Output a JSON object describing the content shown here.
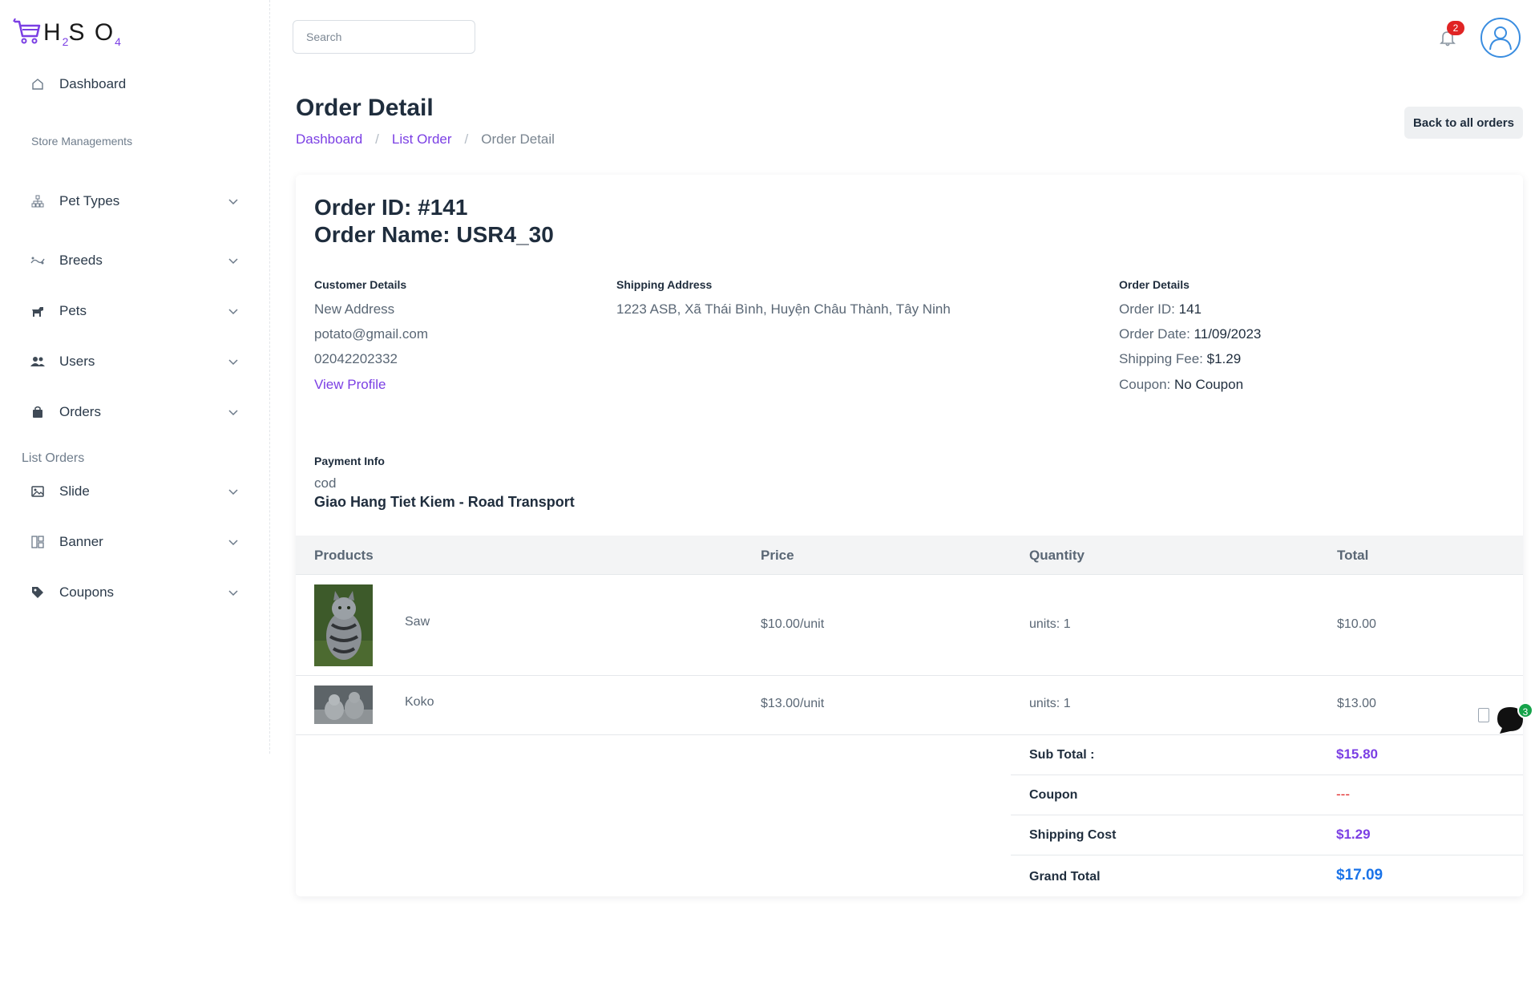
{
  "app": {
    "logo": {
      "letters": [
        "H",
        "S",
        "O"
      ],
      "subscripts": [
        "2",
        "4"
      ]
    }
  },
  "sidebar": {
    "dashboard_label": "Dashboard",
    "section_store": "Store Managements",
    "items": [
      {
        "label": "Pet Types",
        "icon": "sitemap-icon"
      },
      {
        "label": "Breeds",
        "icon": "paw-icon"
      },
      {
        "label": "Pets",
        "icon": "dog-icon"
      },
      {
        "label": "Users",
        "icon": "users-icon"
      },
      {
        "label": "Orders",
        "icon": "bag-icon"
      },
      {
        "label": "Slide",
        "icon": "image-icon"
      },
      {
        "label": "Banner",
        "icon": "layout-icon"
      },
      {
        "label": "Coupons",
        "icon": "tag-icon"
      }
    ],
    "section_list_orders": "List Orders"
  },
  "topbar": {
    "search_placeholder": "Search",
    "notification_count": "2"
  },
  "header": {
    "title": "Order Detail",
    "breadcrumb": [
      "Dashboard",
      "List Order",
      "Order Detail"
    ],
    "back_button": "Back to all orders"
  },
  "order": {
    "id_line": "Order ID: #141",
    "name_line": "Order Name: USR4_30",
    "customer": {
      "title": "Customer Details",
      "address": "New Address",
      "email": "potato@gmail.com",
      "phone": "02042202332",
      "view_profile": "View Profile"
    },
    "shipping": {
      "title": "Shipping Address",
      "address": "1223 ASB, Xã Thái Bình, Huyện Châu Thành, Tây Ninh"
    },
    "details": {
      "title": "Order Details",
      "order_id_label": "Order ID:",
      "order_id_value": "141",
      "order_date_label": "Order Date:",
      "order_date_value": "11/09/2023",
      "shipping_fee_label": "Shipping Fee:",
      "shipping_fee_value": "$1.29",
      "coupon_label": "Coupon:",
      "coupon_value": "No Coupon"
    },
    "payment": {
      "title": "Payment Info",
      "method": "cod",
      "shipping_method": "Giao Hang Tiet Kiem - Road Transport"
    }
  },
  "table": {
    "headers": [
      "Products",
      "Price",
      "Quantity",
      "Total"
    ],
    "rows": [
      {
        "name": "Saw",
        "price": "$10.00/unit",
        "quantity": "units: 1",
        "total": "$10.00"
      },
      {
        "name": "Koko",
        "price": "$13.00/unit",
        "quantity": "units: 1",
        "total": "$13.00"
      }
    ]
  },
  "summary": {
    "subtotal_label": "Sub Total :",
    "subtotal_value": "$15.80",
    "coupon_label": "Coupon",
    "coupon_value": "---",
    "shipping_label": "Shipping Cost",
    "shipping_value": "$1.29",
    "grand_label": "Grand Total",
    "grand_value": "$17.09"
  },
  "chat": {
    "badge": "3"
  },
  "colors": {
    "accent": "#7b3fe4",
    "grand_total": "#1a73e8",
    "coupon_dash": "#e02424",
    "badge_red": "#e02424",
    "badge_green": "#16a34a"
  }
}
